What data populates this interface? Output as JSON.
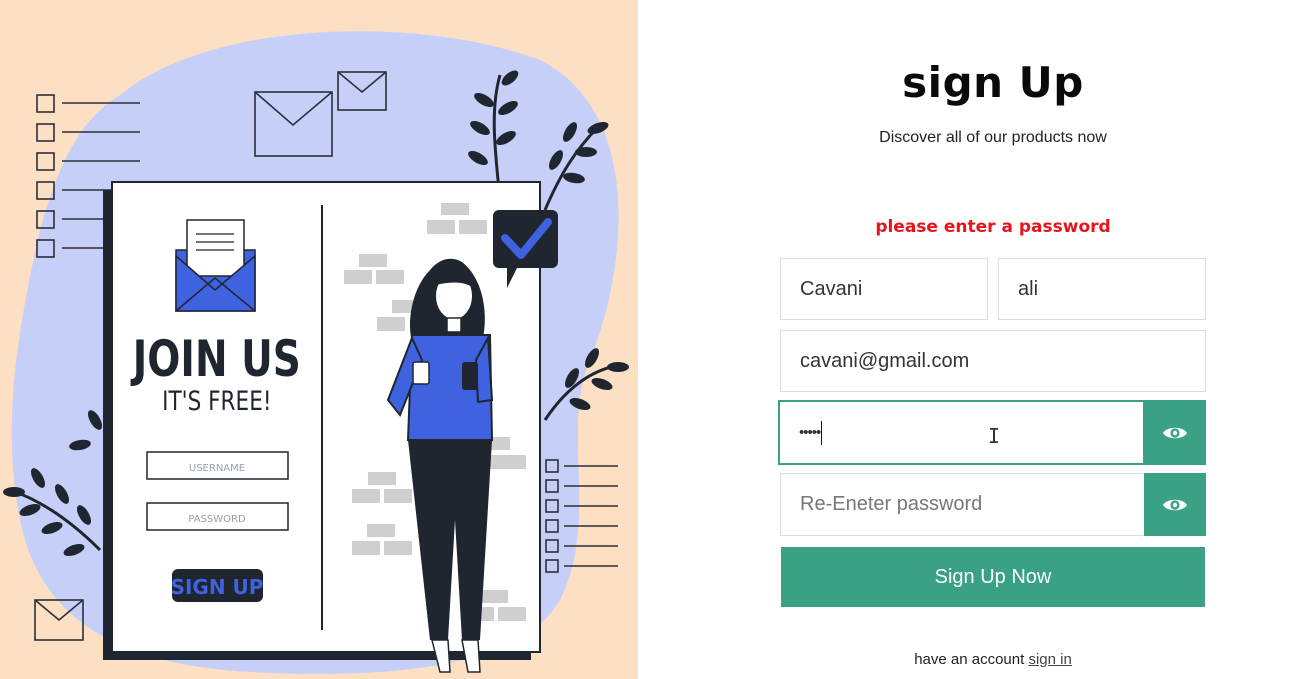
{
  "illustration": {
    "headline": "JOIN US",
    "tagline": "IT'S FREE!",
    "username_placeholder": "USERNAME",
    "password_placeholder": "PASSWORD",
    "button_label": "SIGN UP"
  },
  "form": {
    "title": "sign Up",
    "subtitle": "Discover all of our products now",
    "error": "please enter a password",
    "first_name_value": "Cavani",
    "last_name_value": "ali",
    "email_value": "cavani@gmail.com",
    "password_masked": "•••••",
    "reenter_placeholder": "Re-Eneter password",
    "submit_label": "Sign Up Now",
    "footer_text": "have an account",
    "signin_link": "sign in"
  },
  "icons": {
    "password_toggle": "eye-icon",
    "reenter_toggle": "eye-icon",
    "cursor": "text-cursor-icon"
  },
  "colors": {
    "accent": "#3aa184",
    "error": "#e8141b",
    "panel_bg": "#fde0c4",
    "blob": "#c6cff8",
    "illustration_blue": "#3f63e0"
  }
}
